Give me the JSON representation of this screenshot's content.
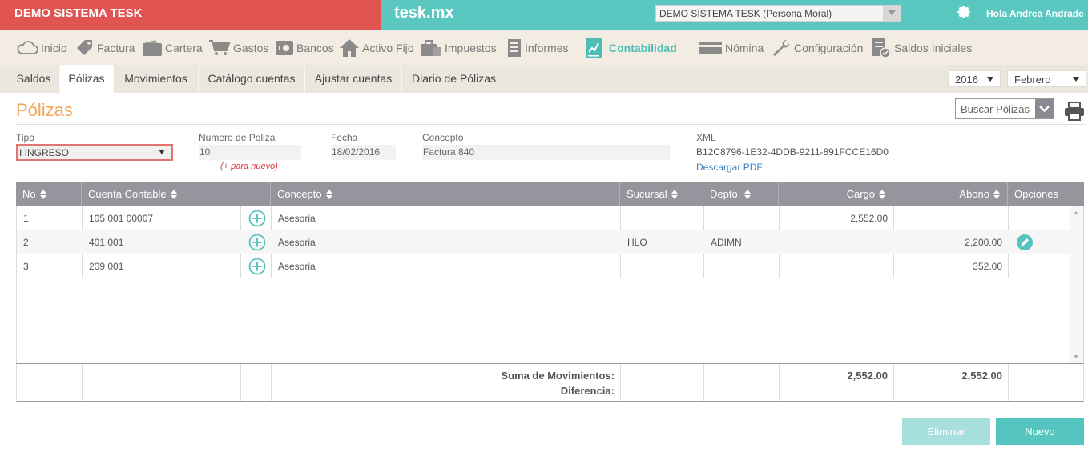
{
  "header": {
    "company_title": "DEMO SISTEMA TESK",
    "brand": "tesk.mx",
    "company_select": "DEMO SISTEMA TESK (Persona Moral)",
    "user_greeting": "Hola Andrea Andrade"
  },
  "main_menu": {
    "items": [
      {
        "label": "Inicio",
        "icon": "cloud-icon"
      },
      {
        "label": "Factura",
        "icon": "tag-icon"
      },
      {
        "label": "Cartera",
        "icon": "wallet-icon"
      },
      {
        "label": "Gastos",
        "icon": "cart-icon"
      },
      {
        "label": "Bancos",
        "icon": "safe-icon"
      },
      {
        "label": "Activo Fijo",
        "icon": "house-icon"
      },
      {
        "label": "Impuestos",
        "icon": "briefcase-icon"
      },
      {
        "label": "Informes",
        "icon": "document-icon"
      },
      {
        "label": "Contabilidad",
        "icon": "chart-icon",
        "active": true
      },
      {
        "label": "Nómina",
        "icon": "card-icon"
      },
      {
        "label": "Configuración",
        "icon": "wrench-icon"
      },
      {
        "label": "Saldos Iniciales",
        "icon": "checklist-icon"
      }
    ]
  },
  "sub_menu": {
    "tabs": [
      "Saldos",
      "Pólizas",
      "Movimientos",
      "Catálogo cuentas",
      "Ajustar cuentas",
      "Diario de Pólizas"
    ],
    "active_tab": "Pólizas",
    "year": "2016",
    "month": "Febrero"
  },
  "page": {
    "title": "Pólizas",
    "search_label": "Buscar Pólizas"
  },
  "form": {
    "tipo_label": "Tipo",
    "tipo_value": "I INGRESO",
    "numero_label": "Numero de Poliza",
    "numero_value": "10",
    "numero_hint": "(+ para nuevo)",
    "fecha_label": "Fecha",
    "fecha_value": "18/02/2016",
    "concepto_label": "Concepto",
    "concepto_value": "Factura 840",
    "xml_label": "XML",
    "xml_value": "B12C8796-1E32-4DDB-9211-891FCCE16D0",
    "pdf_link": "Descargar PDF"
  },
  "table": {
    "headers": {
      "no": "No",
      "cuenta": "Cuenta Contable",
      "concepto": "Concepto",
      "sucursal": "Sucursal",
      "depto": "Depto.",
      "cargo": "Cargo",
      "abono": "Abono",
      "opciones": "Opciones"
    },
    "rows": [
      {
        "no": "1",
        "cuenta": "105 001 00007",
        "concepto": "Asesoria",
        "sucursal": "",
        "depto": "",
        "cargo": "2,552.00",
        "abono": "",
        "edit": false
      },
      {
        "no": "2",
        "cuenta": "401 001",
        "concepto": "Asesoria",
        "sucursal": "HLO",
        "depto": "ADIMN",
        "cargo": "",
        "abono": "2,200.00",
        "edit": true
      },
      {
        "no": "3",
        "cuenta": "209 001",
        "concepto": "Asesoria",
        "sucursal": "",
        "depto": "",
        "cargo": "",
        "abono": "352.00",
        "edit": false
      }
    ],
    "footer": {
      "suma_label": "Suma de Movimientos:",
      "diferencia_label": "Diferencia:",
      "total_cargo": "2,552.00",
      "total_abono": "2,552.00"
    }
  },
  "actions": {
    "eliminar": "Eliminar",
    "nuevo": "Nuevo"
  },
  "colors": {
    "red": "#e05552",
    "teal": "#5ac7c1",
    "orange_title": "#f2a65a",
    "header_gray": "#96959e"
  }
}
